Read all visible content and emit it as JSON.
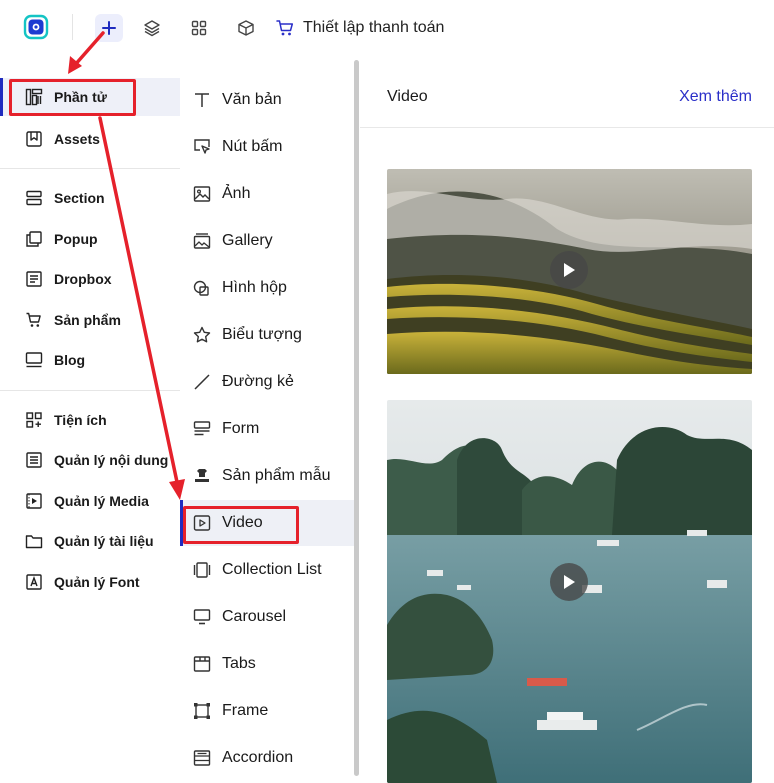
{
  "topbar": {
    "checkout_label": "Thiết lập thanh toán",
    "accent_color": "#1f2bbf"
  },
  "sidebar": {
    "items": [
      {
        "label": "Phần tử",
        "icon": "elements-icon",
        "active": true
      },
      {
        "label": "Assets",
        "icon": "bookmark-icon"
      },
      {
        "label": "Section",
        "icon": "section-icon"
      },
      {
        "label": "Popup",
        "icon": "popup-icon"
      },
      {
        "label": "Dropbox",
        "icon": "dropbox-icon"
      },
      {
        "label": "Sản phẩm",
        "icon": "cart-icon"
      },
      {
        "label": "Blog",
        "icon": "blog-icon"
      },
      {
        "label": "Tiện ích",
        "icon": "widgets-icon"
      },
      {
        "label": "Quản lý nội dung",
        "icon": "content-icon"
      },
      {
        "label": "Quản lý Media",
        "icon": "media-icon"
      },
      {
        "label": "Quản lý tài liệu",
        "icon": "folder-icon"
      },
      {
        "label": "Quản lý Font",
        "icon": "font-icon"
      }
    ]
  },
  "elements": {
    "items": [
      {
        "label": "Văn bản",
        "icon": "text-icon"
      },
      {
        "label": "Nút bấm",
        "icon": "button-cursor-icon"
      },
      {
        "label": "Ảnh",
        "icon": "image-icon"
      },
      {
        "label": "Gallery",
        "icon": "gallery-icon"
      },
      {
        "label": "Hình hộp",
        "icon": "shape-icon"
      },
      {
        "label": "Biểu tượng",
        "icon": "star-icon"
      },
      {
        "label": "Đường kẻ",
        "icon": "line-icon"
      },
      {
        "label": "Form",
        "icon": "form-icon"
      },
      {
        "label": "Sản phẩm mẫu",
        "icon": "product-sample-icon"
      },
      {
        "label": "Video",
        "icon": "video-icon",
        "active": true
      },
      {
        "label": "Collection List",
        "icon": "collection-icon"
      },
      {
        "label": "Carousel",
        "icon": "carousel-icon"
      },
      {
        "label": "Tabs",
        "icon": "tabs-icon"
      },
      {
        "label": "Frame",
        "icon": "frame-icon"
      },
      {
        "label": "Accordion",
        "icon": "accordion-icon"
      }
    ]
  },
  "content": {
    "title": "Video",
    "see_more": "Xem thêm"
  },
  "colors": {
    "annotation_red": "#e5212b",
    "link_blue": "#2a2fc8"
  }
}
